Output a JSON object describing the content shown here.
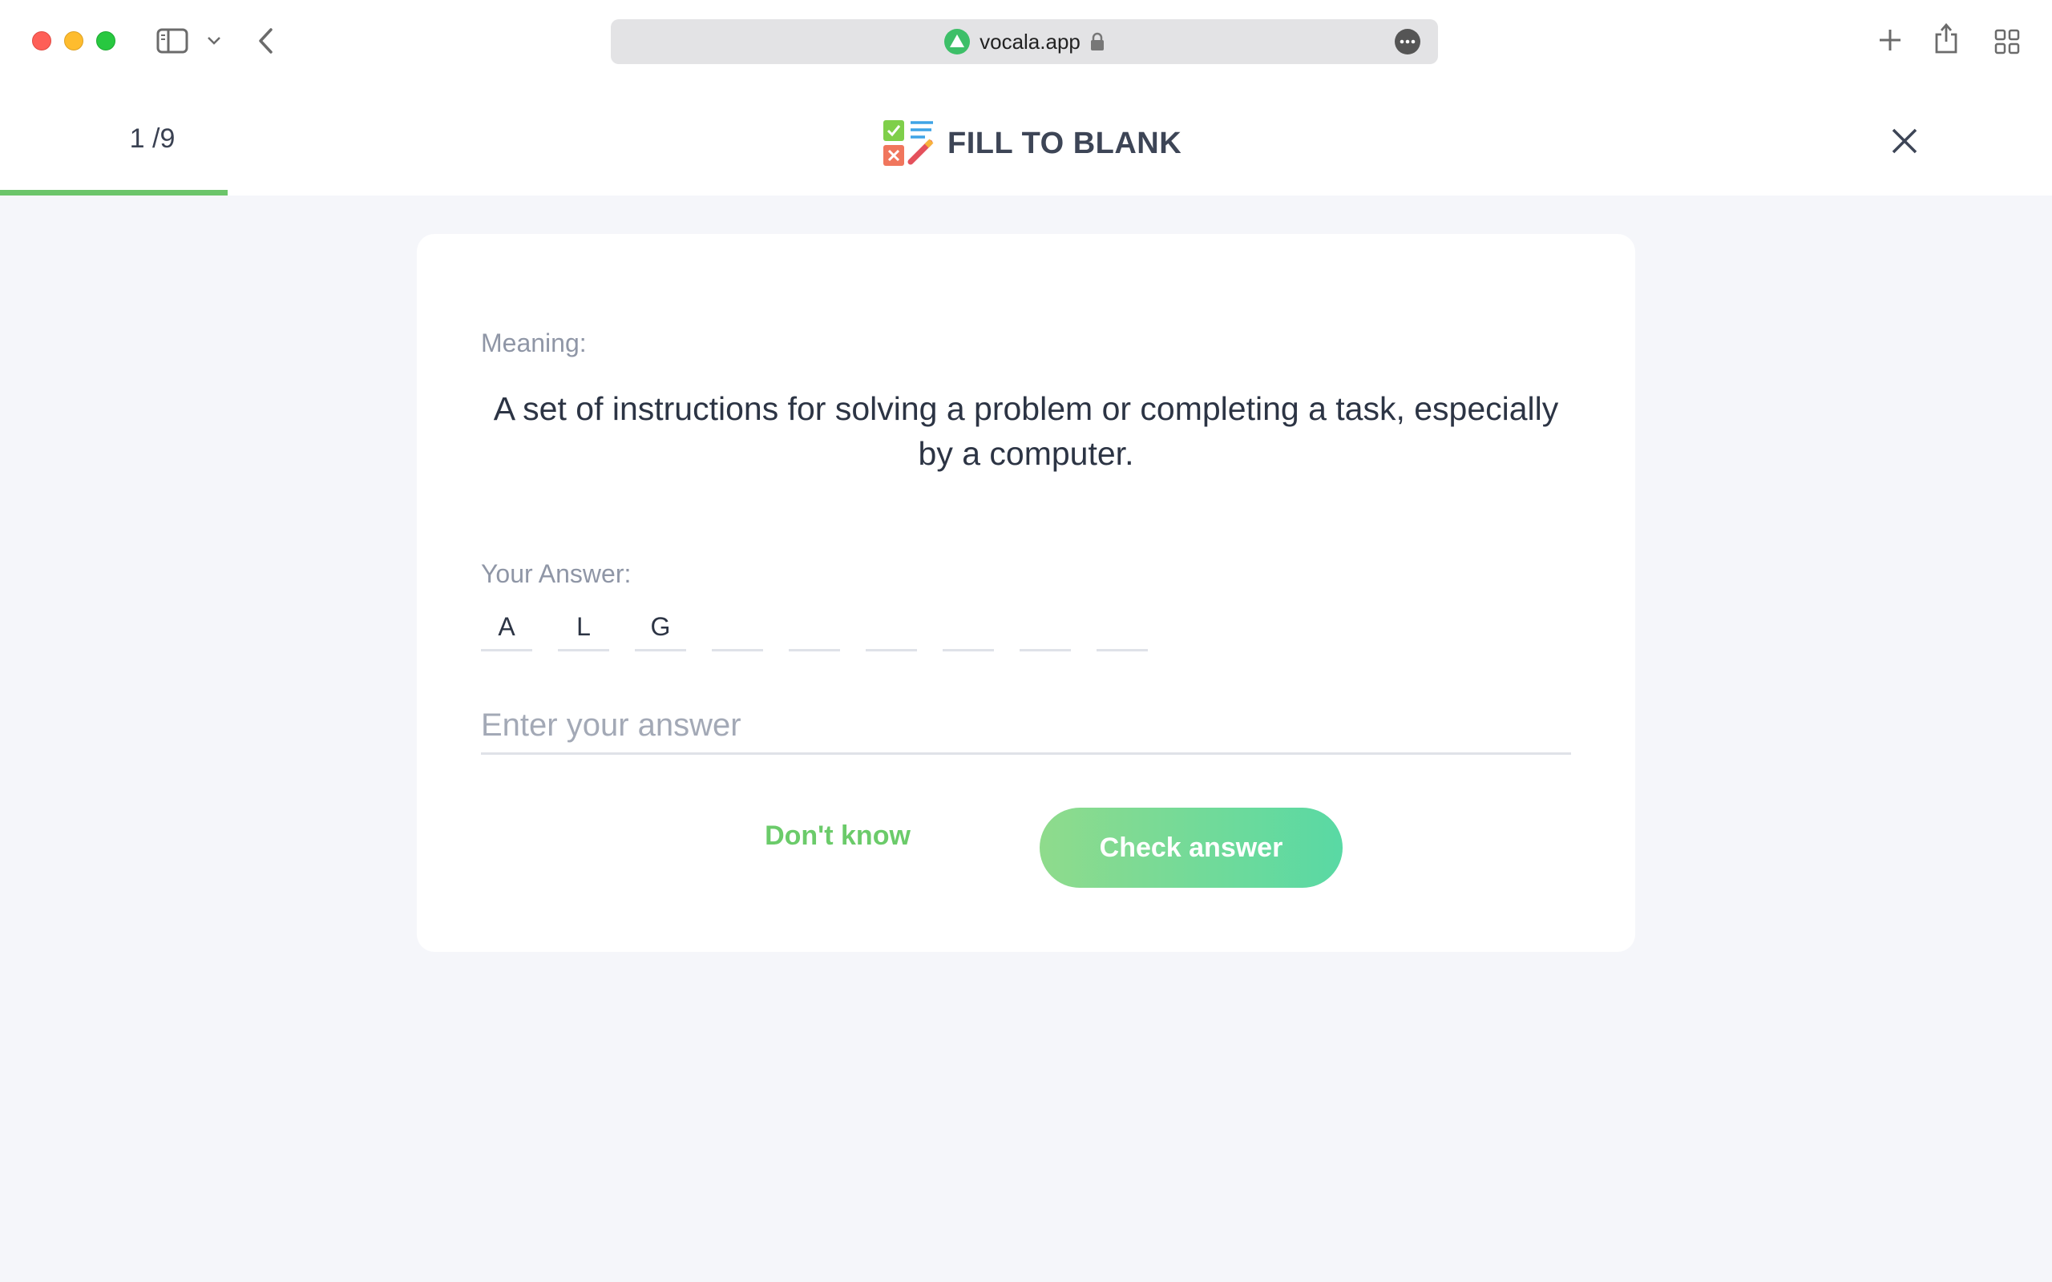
{
  "browser": {
    "url": "vocala.app",
    "icons": [
      "sidebar-icon",
      "chevron-down-icon",
      "back-arrow-icon",
      "site-icon",
      "lock-icon",
      "more-icon",
      "new-tab-icon",
      "share-icon",
      "tab-overview-icon"
    ]
  },
  "header": {
    "progress": "1 /9",
    "progress_fraction": 0.111,
    "title": "FILL TO BLANK",
    "accent_color": "#6cc56a"
  },
  "card": {
    "meaning_label": "Meaning:",
    "meaning_text": "A set of instructions for solving a problem or completing a task, especially by a computer.",
    "answer_label": "Your Answer:",
    "letters": [
      "A",
      "L",
      "G",
      "",
      "",
      "",
      "",
      "",
      ""
    ],
    "input": {
      "value": "",
      "placeholder": "Enter your answer"
    },
    "dont_know_label": "Don't know",
    "check_label": "Check answer"
  }
}
